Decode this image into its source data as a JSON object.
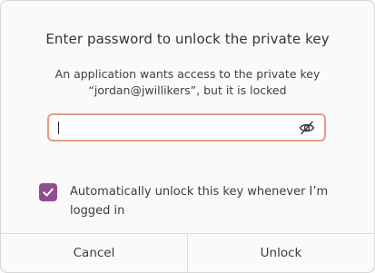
{
  "dialog": {
    "title": "Enter password to unlock the private key",
    "message_line1": "An application wants access to the private key",
    "message_line2": "“jordan@jwillikers”, but it is locked",
    "password": {
      "value": "",
      "reveal_icon": "eye-slash-icon"
    },
    "auto_unlock": {
      "checked": true,
      "label": "Automatically unlock this key whenever I’m logged in"
    },
    "buttons": {
      "cancel": "Cancel",
      "unlock": "Unlock"
    },
    "colors": {
      "accent": "#924d8b",
      "focus_border": "#e99a80"
    }
  }
}
